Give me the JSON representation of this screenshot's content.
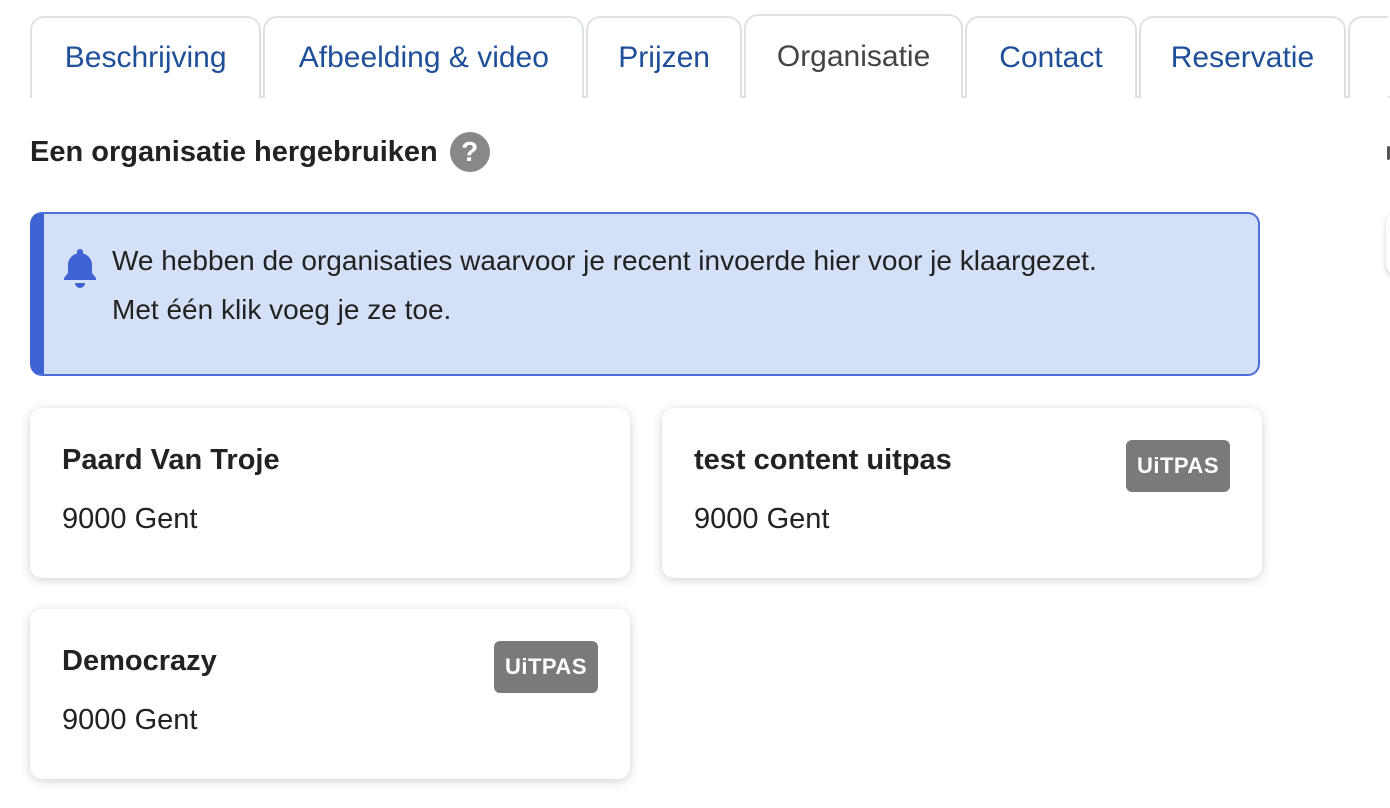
{
  "tabs": [
    {
      "label": "Beschrijving",
      "active": false
    },
    {
      "label": "Afbeelding & video",
      "active": false
    },
    {
      "label": "Prijzen",
      "active": false
    },
    {
      "label": "Organisatie",
      "active": true
    },
    {
      "label": "Contact",
      "active": false
    },
    {
      "label": "Reservatie",
      "active": false
    }
  ],
  "section": {
    "heading": "Een organisatie hergebruiken",
    "help_icon": "?"
  },
  "alert": {
    "icon": "bell-icon",
    "line1": "We hebben de organisaties waarvoor je recent invoerde hier voor je klaargezet.",
    "line2": "Met één klik voeg je ze toe."
  },
  "organizations": [
    {
      "name": "Paard Van Troje",
      "address": "9000 Gent",
      "badge": ""
    },
    {
      "name": "test content uitpas",
      "address": "9000 Gent",
      "badge": "UiTPAS"
    },
    {
      "name": "Democrazy",
      "address": "9000 Gent",
      "badge": "UiTPAS"
    }
  ],
  "colors": {
    "tab_link": "#1f4f99",
    "alert_bg": "#d4e0f7",
    "alert_border": "#3f63d3",
    "badge_bg": "#7a7a7a"
  }
}
